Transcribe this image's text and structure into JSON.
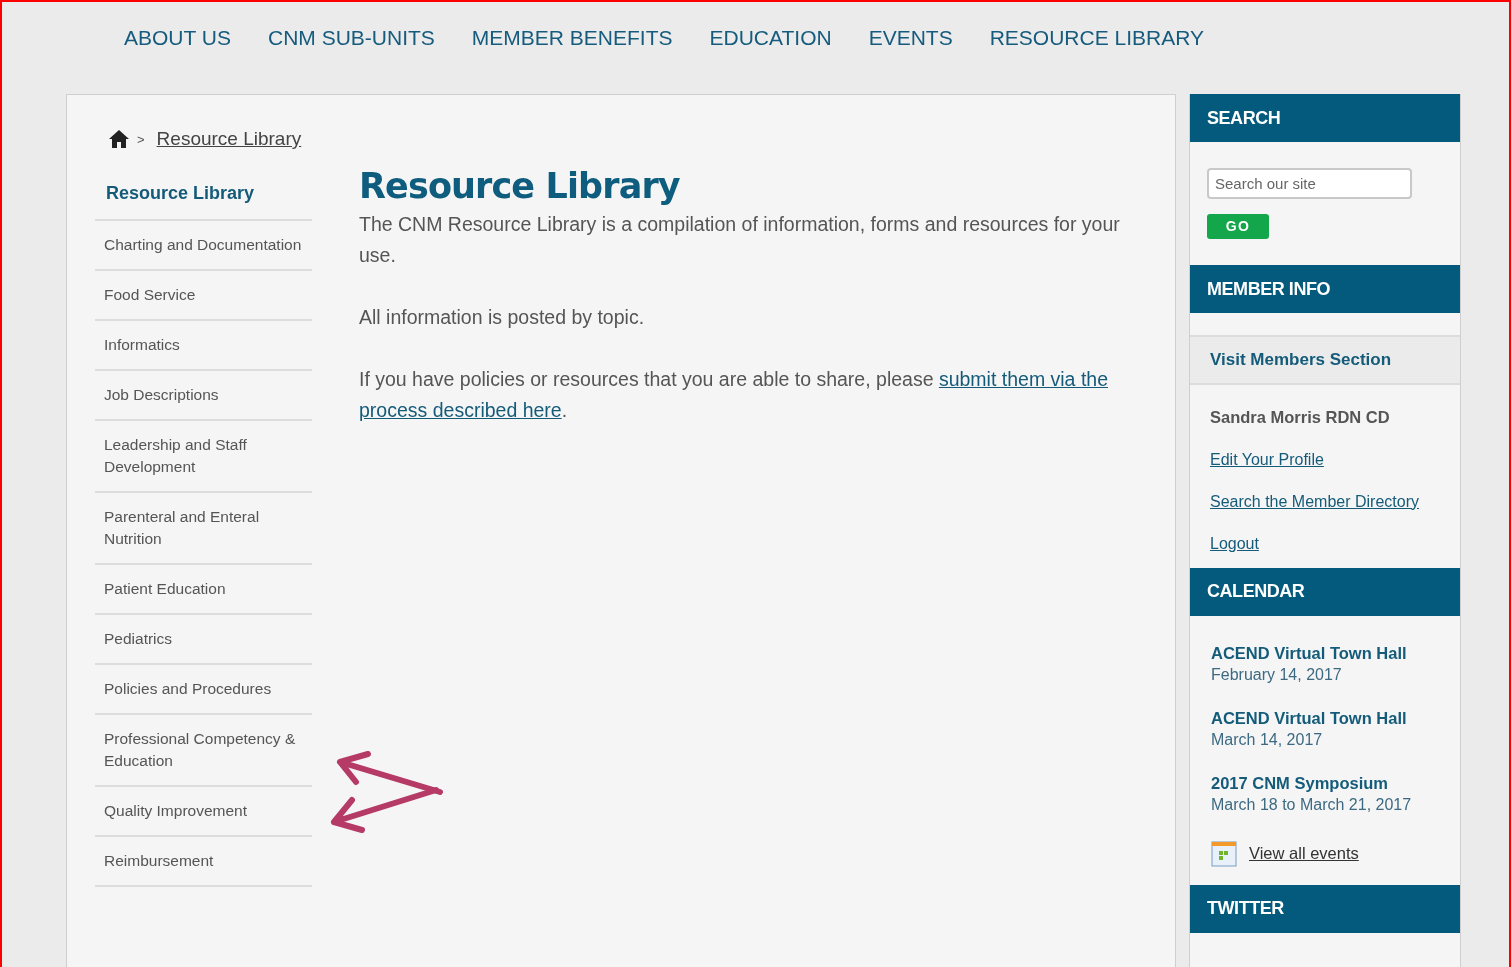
{
  "nav": [
    "ABOUT US",
    "CNM SUB-UNITS",
    "MEMBER BENEFITS",
    "EDUCATION",
    "EVENTS",
    "RESOURCE LIBRARY"
  ],
  "breadcrumb": {
    "separator": ">",
    "current": "Resource Library"
  },
  "side_menu": {
    "title": "Resource Library",
    "items": [
      "Charting and Documentation",
      "Food Service",
      "Informatics",
      "Job Descriptions",
      "Leadership and Staff Development",
      "Parenteral and Enteral Nutrition",
      "Patient Education",
      "Pediatrics",
      "Policies and Procedures",
      "Professional Competency & Education",
      "Quality Improvement",
      "Reimbursement"
    ]
  },
  "main": {
    "title": "Resource Library",
    "intro": "The CNM Resource Library is a compilation of information, forms and resources for your use.",
    "note": "All information is posted by topic.",
    "share": {
      "text": "If you have policies or resources that you are able to share, please ",
      "link": [
        "submit them via the",
        "process described here"
      ],
      "after": "."
    }
  },
  "search": {
    "title": "SEARCH",
    "placeholder": "Search our site",
    "button": "GO"
  },
  "member_info": {
    "title": "MEMBER INFO",
    "section_link": "Visit Members Section",
    "name": "Sandra Morris RDN CD",
    "links": [
      "Edit Your Profile",
      "Search the Member Directory",
      "Logout"
    ]
  },
  "calendar": {
    "title": "CALENDAR",
    "events": [
      {
        "name": "ACEND Virtual Town Hall",
        "date": "February 14, 2017"
      },
      {
        "name": "ACEND Virtual Town Hall",
        "date": "March 14, 2017"
      },
      {
        "name": "2017 CNM Symposium",
        "date": "March 18 to March 21, 2017"
      }
    ],
    "view_all": "View all events"
  },
  "twitter": {
    "title": "TWITTER"
  }
}
